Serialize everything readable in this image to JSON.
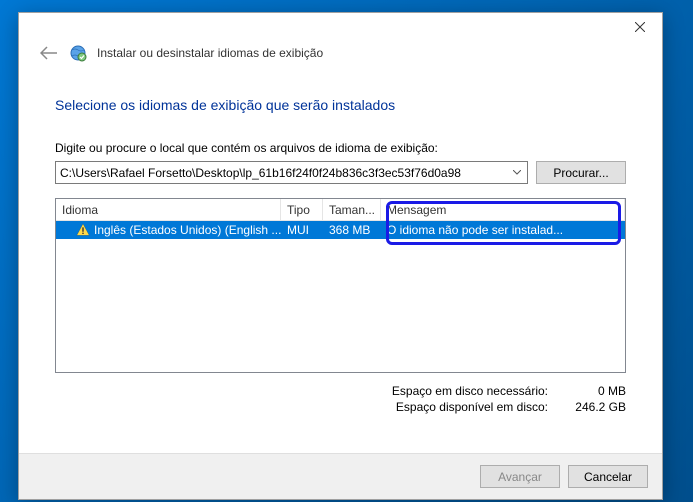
{
  "window": {
    "title": "Instalar ou desinstalar idiomas de exibição"
  },
  "heading": "Selecione os idiomas de exibição que serão instalados",
  "pathLabel": "Digite ou procure o local que contém os arquivos de idioma de exibição:",
  "pathValue": "C:\\Users\\Rafael Forsetto\\Desktop\\lp_61b16f24f0f24b836c3f3ec53f76d0a98",
  "browseBtn": "Procurar...",
  "columns": {
    "language": "Idioma",
    "type": "Tipo",
    "size": "Taman...",
    "message": "Mensagem"
  },
  "row": {
    "language": "Inglês (Estados Unidos) (English ...",
    "type": "MUI",
    "size": "368 MB",
    "message": "O idioma não pode ser instalad..."
  },
  "disk": {
    "requiredLabel": "Espaço em disco necessário:",
    "requiredVal": "0 MB",
    "availableLabel": "Espaço disponível em disco:",
    "availableVal": "246.2 GB"
  },
  "footer": {
    "next": "Avançar",
    "cancel": "Cancelar"
  }
}
